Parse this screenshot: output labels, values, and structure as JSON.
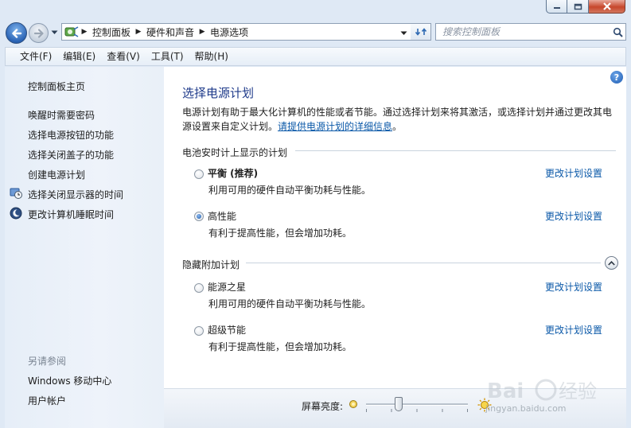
{
  "window": {
    "controls": {
      "minimize": "minimize-icon",
      "maximize": "maximize-icon",
      "close": "close-icon"
    }
  },
  "address": {
    "crumbs": [
      "控制面板",
      "硬件和声音",
      "电源选项"
    ],
    "search_placeholder": "搜索控制面板"
  },
  "menu": [
    "文件(F)",
    "编辑(E)",
    "查看(V)",
    "工具(T)",
    "帮助(H)"
  ],
  "sidebar": {
    "home": "控制面板主页",
    "links": [
      "唤醒时需要密码",
      "选择电源按钮的功能",
      "选择关闭盖子的功能",
      "创建电源计划",
      "选择关闭显示器的时间",
      "更改计算机睡眠时间"
    ],
    "see_also_heading": "另请参阅",
    "see_also": [
      "Windows 移动中心",
      "用户帐户"
    ]
  },
  "main": {
    "title": "选择电源计划",
    "intro": "电源计划有助于最大化计算机的性能或者节能。通过选择计划来将其激活，或选择计划并通过更改其电源设置来自定义计划。",
    "intro_link": "请提供电源计划的详细信息",
    "intro_end": "。",
    "group1_heading": "电池安时计上显示的计划",
    "group2_heading": "隐藏附加计划",
    "change_link": "更改计划设置",
    "plans": [
      {
        "name": "平衡 (推荐)",
        "desc": "利用可用的硬件自动平衡功耗与性能。",
        "selected": false
      },
      {
        "name": "高性能",
        "desc": "有利于提高性能，但会增加功耗。",
        "selected": true
      },
      {
        "name": "能源之星",
        "desc": "利用可用的硬件自动平衡功耗与性能。",
        "selected": false
      },
      {
        "name": "超级节能",
        "desc": "有利于提高性能，但会增加功耗。",
        "selected": false
      }
    ]
  },
  "brightness": {
    "label": "屏幕亮度:",
    "level": 0.32
  },
  "watermark": {
    "logo": "Baidu经验",
    "url": "jingyan.baidu.com"
  }
}
